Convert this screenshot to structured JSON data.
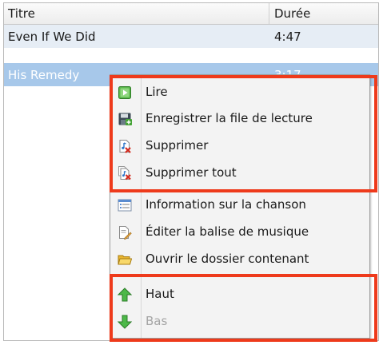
{
  "list": {
    "columns": {
      "title": "Titre",
      "duration": "Durée"
    },
    "rows": [
      {
        "title": "Even If We Did",
        "duration": "4:47"
      },
      {
        "title": "His Remedy",
        "duration": "3:17"
      }
    ]
  },
  "context_menu": {
    "group1": [
      {
        "label": "Lire",
        "icon": "play-icon"
      },
      {
        "label": "Enregistrer la file de lecture",
        "icon": "save-icon"
      },
      {
        "label": "Supprimer",
        "icon": "delete-icon"
      },
      {
        "label": "Supprimer tout",
        "icon": "delete-all-icon"
      }
    ],
    "group2": [
      {
        "label": "Information sur la chanson",
        "icon": "info-icon"
      },
      {
        "label": "Éditer la balise de musique",
        "icon": "edit-tag-icon"
      },
      {
        "label": "Ouvrir le dossier contenant",
        "icon": "folder-icon"
      }
    ],
    "group3": [
      {
        "label": "Haut",
        "icon": "arrow-up-icon"
      },
      {
        "label": "Bas",
        "icon": "arrow-down-icon",
        "disabled": true
      }
    ]
  },
  "highlight_color": "#ee3a1b"
}
